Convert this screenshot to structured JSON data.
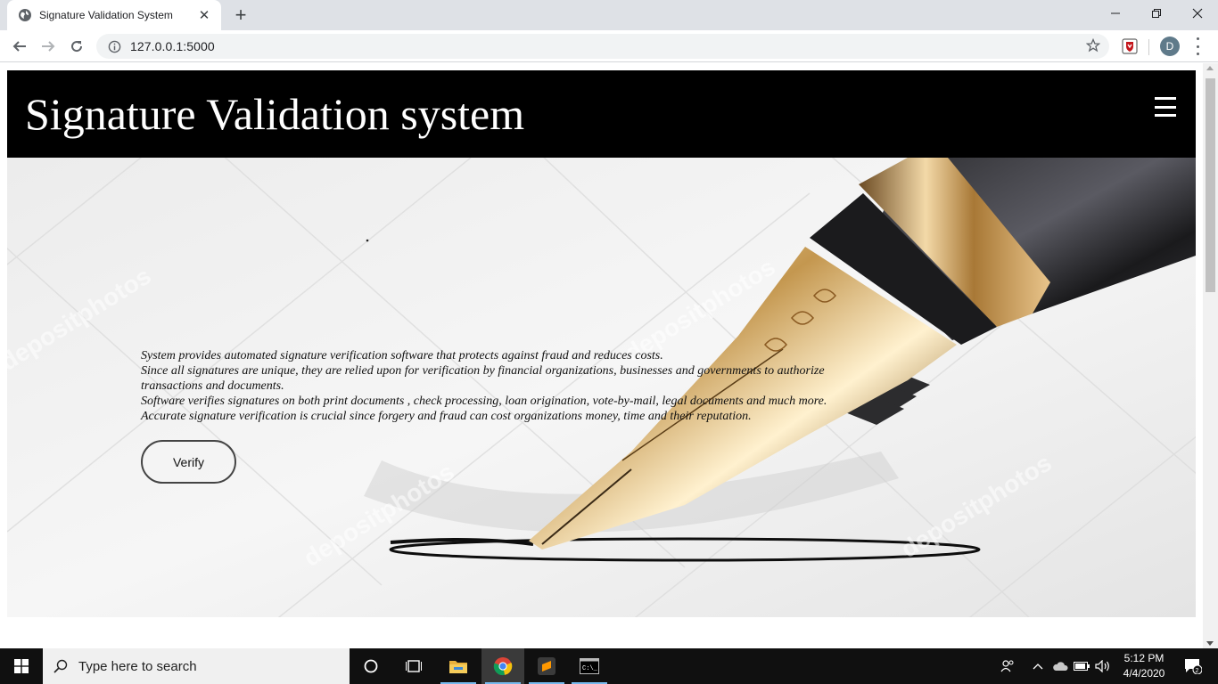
{
  "browser": {
    "tab_title": "Signature Validation System",
    "new_tab_symbol": "+",
    "close_tab_symbol": "✕",
    "url": "127.0.0.1:5000",
    "profile_initial": "D"
  },
  "window_controls": {
    "minimize": "—",
    "maximize": "❐",
    "close": "✕"
  },
  "site": {
    "title": "Signature Validation system",
    "hero_lines": [
      "System provides automated signature verification software that protects against fraud and reduces costs.",
      "Since all signatures are unique, they are relied upon for verification by financial organizations, businesses and governments to authorize transactions and documents.",
      "Software verifies signatures on both print documents , check processing, loan origination, vote-by-mail, legal documents and much more. Accurate signature verification is crucial since forgery and fraud can cost organizations money, time and their reputation."
    ],
    "verify_label": "Verify",
    "watermark": "depositphotos"
  },
  "taskbar": {
    "search_placeholder": "Type here to search",
    "time": "5:12 PM",
    "date": "4/4/2020",
    "notification_count": "2"
  },
  "colors": {
    "header_bg": "#000000",
    "tabstrip_bg": "#dee1e6",
    "taskbar_bg": "#101010",
    "chrome_accent": "#76b9ed"
  }
}
